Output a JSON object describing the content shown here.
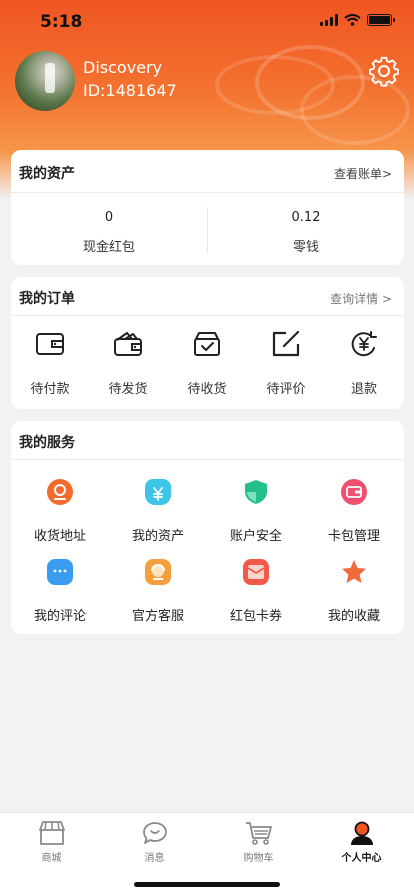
{
  "status": {
    "time": "5:18"
  },
  "profile": {
    "name": "Discovery",
    "id": "ID:1481647"
  },
  "assets": {
    "title": "我的资产",
    "link": "查看账单>",
    "items": [
      {
        "value": "0",
        "label": "现金红包"
      },
      {
        "value": "0.12",
        "label": "零钱"
      }
    ]
  },
  "orders": {
    "title": "我的订单",
    "link": "查询详情 >",
    "items": [
      {
        "label": "待付款",
        "icon": "wallet-icon"
      },
      {
        "label": "待发货",
        "icon": "purse-icon"
      },
      {
        "label": "待收货",
        "icon": "box-check-icon"
      },
      {
        "label": "待评价",
        "icon": "edit-icon"
      },
      {
        "label": "退款",
        "icon": "yen-refund-icon"
      }
    ]
  },
  "services": {
    "title": "我的服务",
    "items": [
      {
        "label": "收货地址",
        "icon": "location-icon",
        "color": "#f36b2c"
      },
      {
        "label": "我的资产",
        "icon": "money-bag-icon",
        "color": "#3cc5e8"
      },
      {
        "label": "账户安全",
        "icon": "shield-icon",
        "color": "#24c08a"
      },
      {
        "label": "卡包管理",
        "icon": "card-wallet-icon",
        "color": "#f0506e"
      },
      {
        "label": "我的评论",
        "icon": "chat-icon",
        "color": "#3a9cf0"
      },
      {
        "label": "官方客服",
        "icon": "service-icon",
        "color": "#f5a03c"
      },
      {
        "label": "红包卡券",
        "icon": "coupon-icon",
        "color": "#f05a4a"
      },
      {
        "label": "我的收藏",
        "icon": "star-icon",
        "color": "#f26a3a"
      }
    ]
  },
  "tabbar": {
    "items": [
      {
        "label": "商城",
        "icon": "shop-icon"
      },
      {
        "label": "消息",
        "icon": "message-icon"
      },
      {
        "label": "购物车",
        "icon": "cart-icon"
      },
      {
        "label": "个人中心",
        "icon": "person-icon",
        "active": true
      }
    ]
  },
  "colors": {
    "accent": "#f05522",
    "background": "#f2f2f4"
  }
}
